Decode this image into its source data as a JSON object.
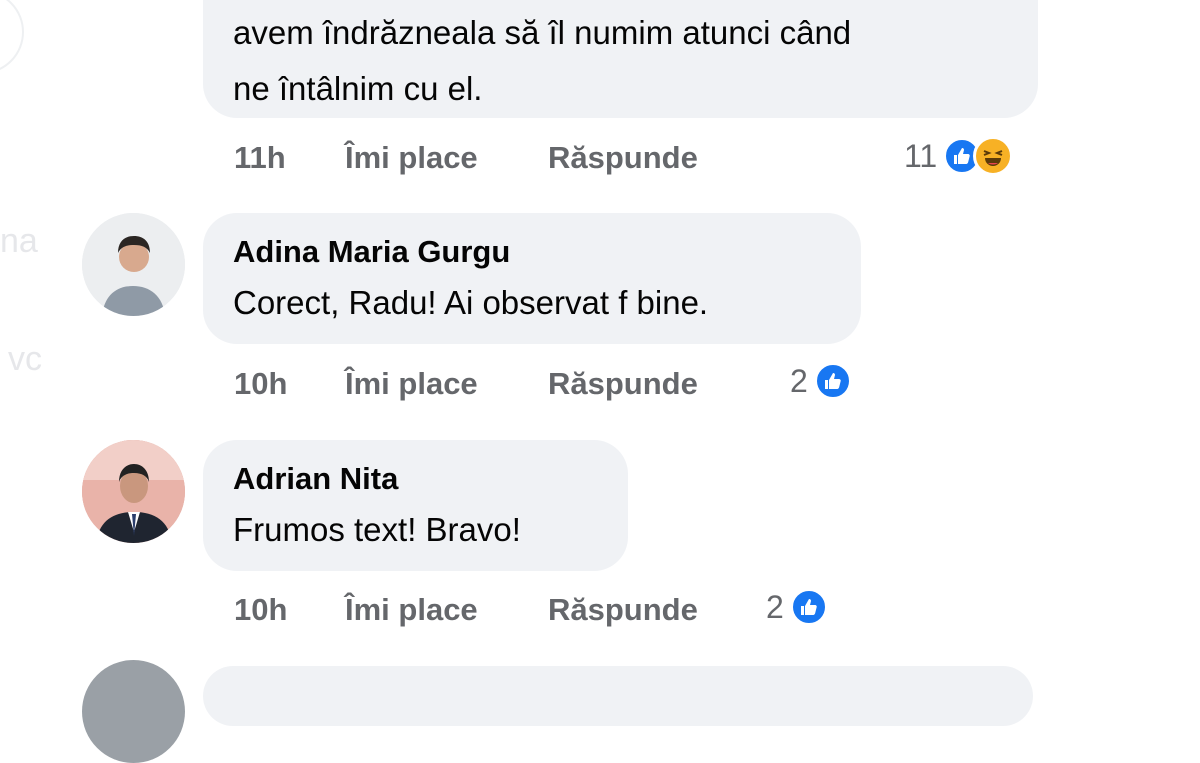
{
  "comments": [
    {
      "author": "",
      "text_lines": [
        "avem îndrăzneala să îl numim atunci când",
        "ne întâlnim cu el."
      ],
      "time": "11h",
      "like_label": "Îmi place",
      "reply_label": "Răspunde",
      "reaction_count": "11",
      "reactions": [
        "like-icon",
        "haha-icon"
      ]
    },
    {
      "author": "Adina Maria Gurgu",
      "text": "Corect, Radu! Ai observat f bine.",
      "time": "10h",
      "like_label": "Îmi place",
      "reply_label": "Răspunde",
      "reaction_count": "2",
      "reactions": [
        "like-icon"
      ]
    },
    {
      "author": "Adrian Nita",
      "text": "Frumos text! Bravo!",
      "time": "10h",
      "like_label": "Îmi place",
      "reply_label": "Răspunde",
      "reaction_count": "2",
      "reactions": [
        "like-icon"
      ]
    }
  ],
  "side_fragments": [
    "na",
    "vc"
  ],
  "colors": {
    "bubble": "#f0f2f5",
    "meta": "#65676b",
    "like_blue": "#1877f2",
    "haha_yellow": "#f7b125"
  }
}
